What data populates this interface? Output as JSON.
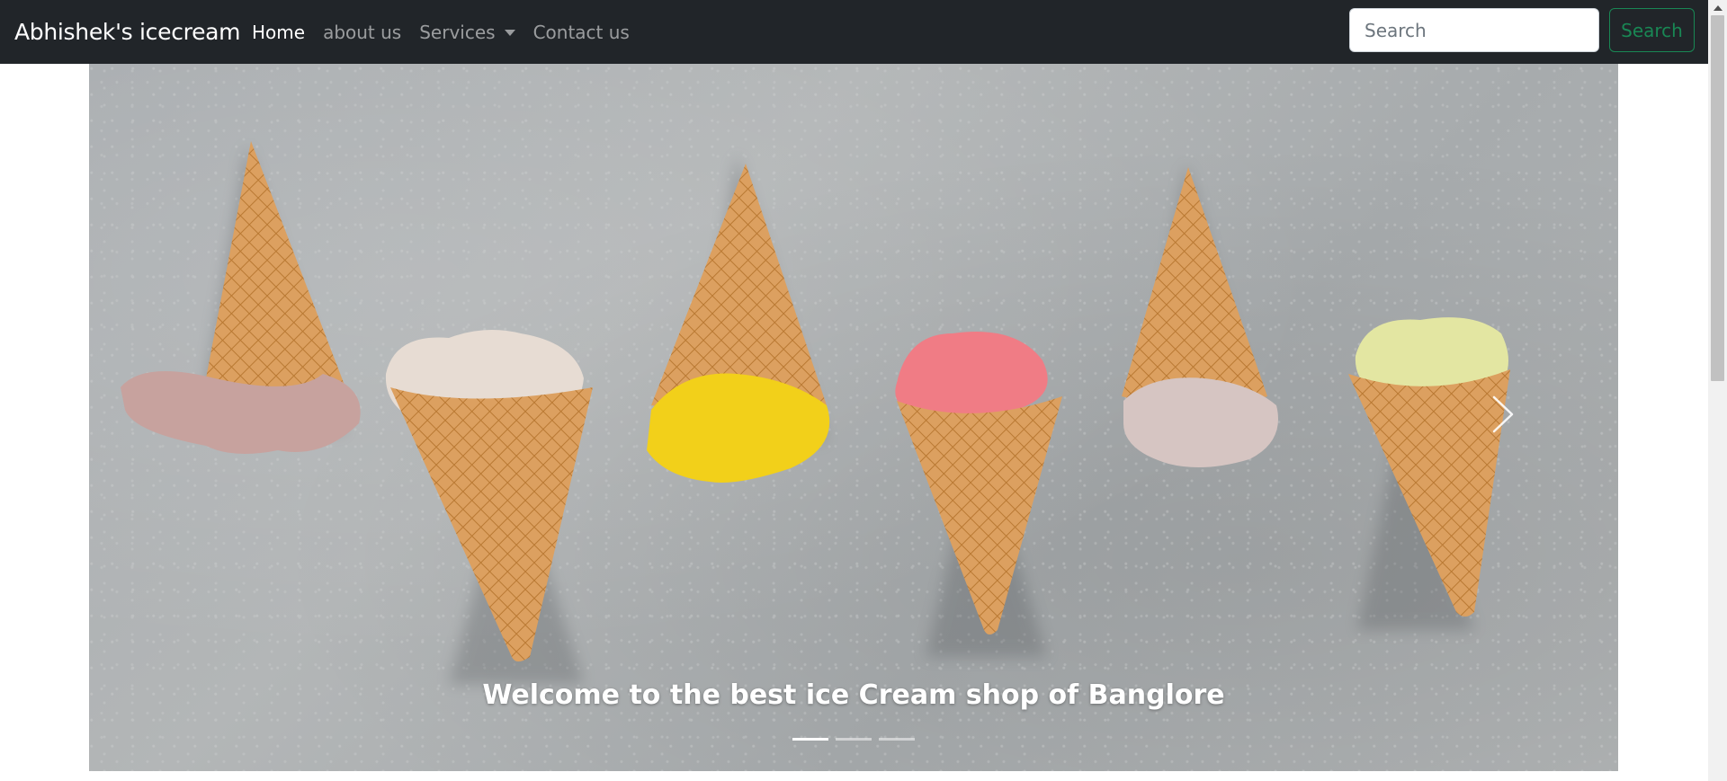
{
  "navbar": {
    "brand": "Abhishek's icecream",
    "links": [
      {
        "label": "Home",
        "active": true
      },
      {
        "label": "about us",
        "active": false
      },
      {
        "label": "Services",
        "active": false,
        "dropdown": true
      },
      {
        "label": "Contact us",
        "active": false
      }
    ],
    "search": {
      "placeholder": "Search",
      "button_label": "Search"
    }
  },
  "carousel": {
    "caption": "Welcome to the best ice Cream shop of Banglore",
    "slide_count": 3,
    "active_slide": 1,
    "next_icon": "chevron-right-icon"
  },
  "colors": {
    "navbar_bg": "#212529",
    "search_button": "#198754",
    "cone": "#d99a52",
    "scoop_colors": [
      "#c9a5a2",
      "#e8dcd4",
      "#f3d21c",
      "#f17d86",
      "#d7c6c3",
      "#e4e7a3"
    ]
  }
}
